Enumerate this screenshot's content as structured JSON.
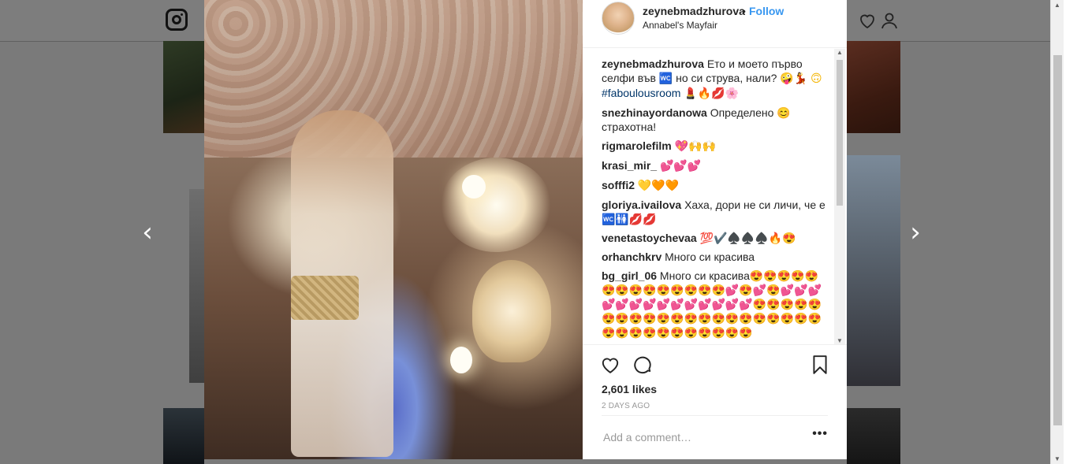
{
  "post": {
    "username": "zeynebmadzhurova",
    "separator": "•",
    "follow_label": "Follow",
    "location": "Annabel's Mayfair"
  },
  "comments": [
    {
      "user": "zeynebmadzhurova",
      "text": "Ето и моето първо селфи във 🚾 но си струва, нали? 🤪💃",
      "hashtag": "#faboulousroom",
      "tail": "💄🔥💋🌸",
      "lead": "🙃"
    },
    {
      "user": "snezhinayordanowa",
      "text": "Определено 😊 страхотна!"
    },
    {
      "user": "rigmarolefilm",
      "text": "💖🙌🙌"
    },
    {
      "user": "krasi_mir_",
      "text": "💕💕💕"
    },
    {
      "user": "sofffi2",
      "text": "💛🧡🧡"
    },
    {
      "user": "gloriya.ivailova",
      "text": "Хаха, дори не си личи, че е 🚾🚻💋💋"
    },
    {
      "user": "venetastoychevaa",
      "text": "💯✔️♠️♠️♠️🔥😍"
    },
    {
      "user": "orhanchkrv",
      "text": "Много си красива"
    },
    {
      "user": "bg_girl_06",
      "text": "Много си красива😍😍😍😍😍😍😍😍😍😍😍😍😍😍💕😍💕😍💕💕💕💕💕💕💕💕💕💕💕💕💕💕😍😍😍😍😍😍😍😍😍😍😍😍😍😍😍😍😍😍😍😍😍😍😍😍😍😍😍😍😍😍😍😍"
    }
  ],
  "actions": {
    "likes": "2,601 likes",
    "time_ago": "2 DAYS AGO",
    "comment_placeholder": "Add a comment…",
    "more": "•••"
  },
  "nav": {
    "prev": "‹",
    "next": "›"
  },
  "icons": [
    "instagram-logo-icon",
    "heart-icon",
    "comment-icon",
    "bookmark-icon",
    "profile-icon",
    "more-icon"
  ],
  "colors": {
    "link": "#3897f0",
    "text": "#262626",
    "muted": "#999999",
    "overlay": "#6b6b6b"
  }
}
